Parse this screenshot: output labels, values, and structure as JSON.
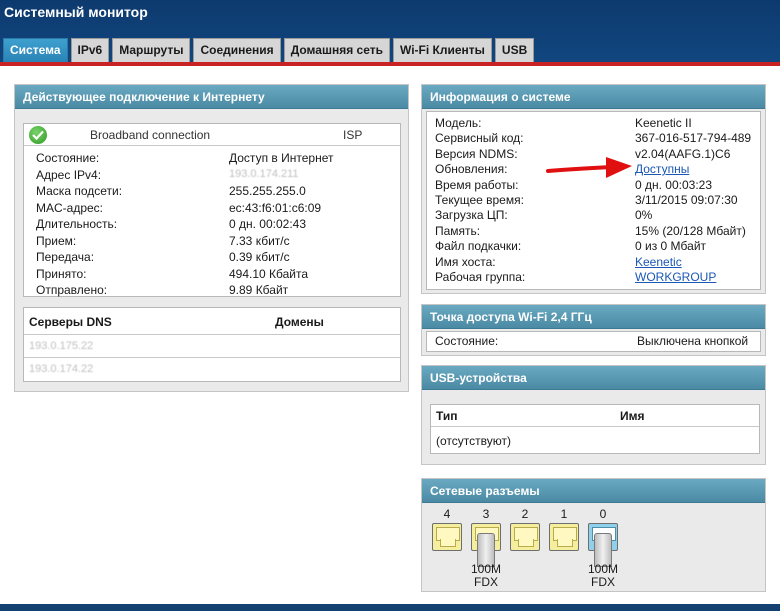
{
  "app_title": "Системный монитор",
  "tabs": [
    "Система",
    "IPv6",
    "Маршруты",
    "Соединения",
    "Домашняя сеть",
    "Wi-Fi Клиенты",
    "USB"
  ],
  "active_tab": "Система",
  "internet": {
    "title": "Действующее подключение к Интернету",
    "connection_name": "Broadband connection",
    "connection_type": "ISP",
    "rows": [
      {
        "label": "Состояние:",
        "value": "Доступ в Интернет"
      },
      {
        "label": "Адрес IPv4:",
        "value": "193.0.174.211"
      },
      {
        "label": "Маска подсети:",
        "value": "255.255.255.0"
      },
      {
        "label": "MAC-адрес:",
        "value": "ec:43:f6:01:c6:09"
      },
      {
        "label": "Длительность:",
        "value": "0 дн. 00:02:43"
      },
      {
        "label": "Прием:",
        "value": "7.33 кбит/с"
      },
      {
        "label": "Передача:",
        "value": "0.39 кбит/с"
      },
      {
        "label": "Принято:",
        "value": "494.10 Кбайта"
      },
      {
        "label": "Отправлено:",
        "value": "9.89 Кбайт"
      }
    ],
    "dns_header": "Серверы DNS",
    "domains_header": "Домены",
    "dns_servers": [
      "193.0.175.22",
      "193.0.174.22"
    ]
  },
  "sysinfo": {
    "title": "Информация о системе",
    "rows": [
      {
        "label": "Модель:",
        "value": "Keenetic II"
      },
      {
        "label": "Сервисный код:",
        "value": "367-016-517-794-489"
      },
      {
        "label": "Версия NDMS:",
        "value": "v2.04(AAFG.1)C6"
      },
      {
        "label": "Обновления:",
        "value": "Доступны"
      },
      {
        "label": "Время работы:",
        "value": "0 дн. 00:03:23"
      },
      {
        "label": "Текущее время:",
        "value": "3/11/2015 09:07:30"
      },
      {
        "label": "Загрузка ЦП:",
        "value": "0%"
      },
      {
        "label": "Память:",
        "value": "15% (20/128 Мбайт)"
      },
      {
        "label": "Файл подкачки:",
        "value": "0 из 0 Мбайт"
      },
      {
        "label": "Имя хоста:",
        "value": "Keenetic"
      },
      {
        "label": "Рабочая группа:",
        "value": "WORKGROUP"
      }
    ]
  },
  "wifi": {
    "title": "Точка доступа Wi-Fi 2,4 ГГц",
    "label": "Состояние:",
    "value": "Выключена кнопкой"
  },
  "usb": {
    "title": "USB-устройства",
    "col_type": "Тип",
    "col_name": "Имя",
    "empty": "(отсутствуют)"
  },
  "ports": {
    "title": "Сетевые разъемы",
    "items": [
      {
        "label": "4",
        "connected": false,
        "speed": "",
        "duplex": ""
      },
      {
        "label": "3",
        "connected": true,
        "speed": "100M",
        "duplex": "FDX"
      },
      {
        "label": "2",
        "connected": false,
        "speed": "",
        "duplex": ""
      },
      {
        "label": "1",
        "connected": false,
        "speed": "",
        "duplex": ""
      },
      {
        "label": "0",
        "connected": true,
        "speed": "100M",
        "duplex": "FDX"
      }
    ]
  },
  "colors": {
    "accent_red": "#c92222",
    "header_blue": "#11467f",
    "panel_head": "#5b9ab3",
    "link": "#1b57b4"
  }
}
